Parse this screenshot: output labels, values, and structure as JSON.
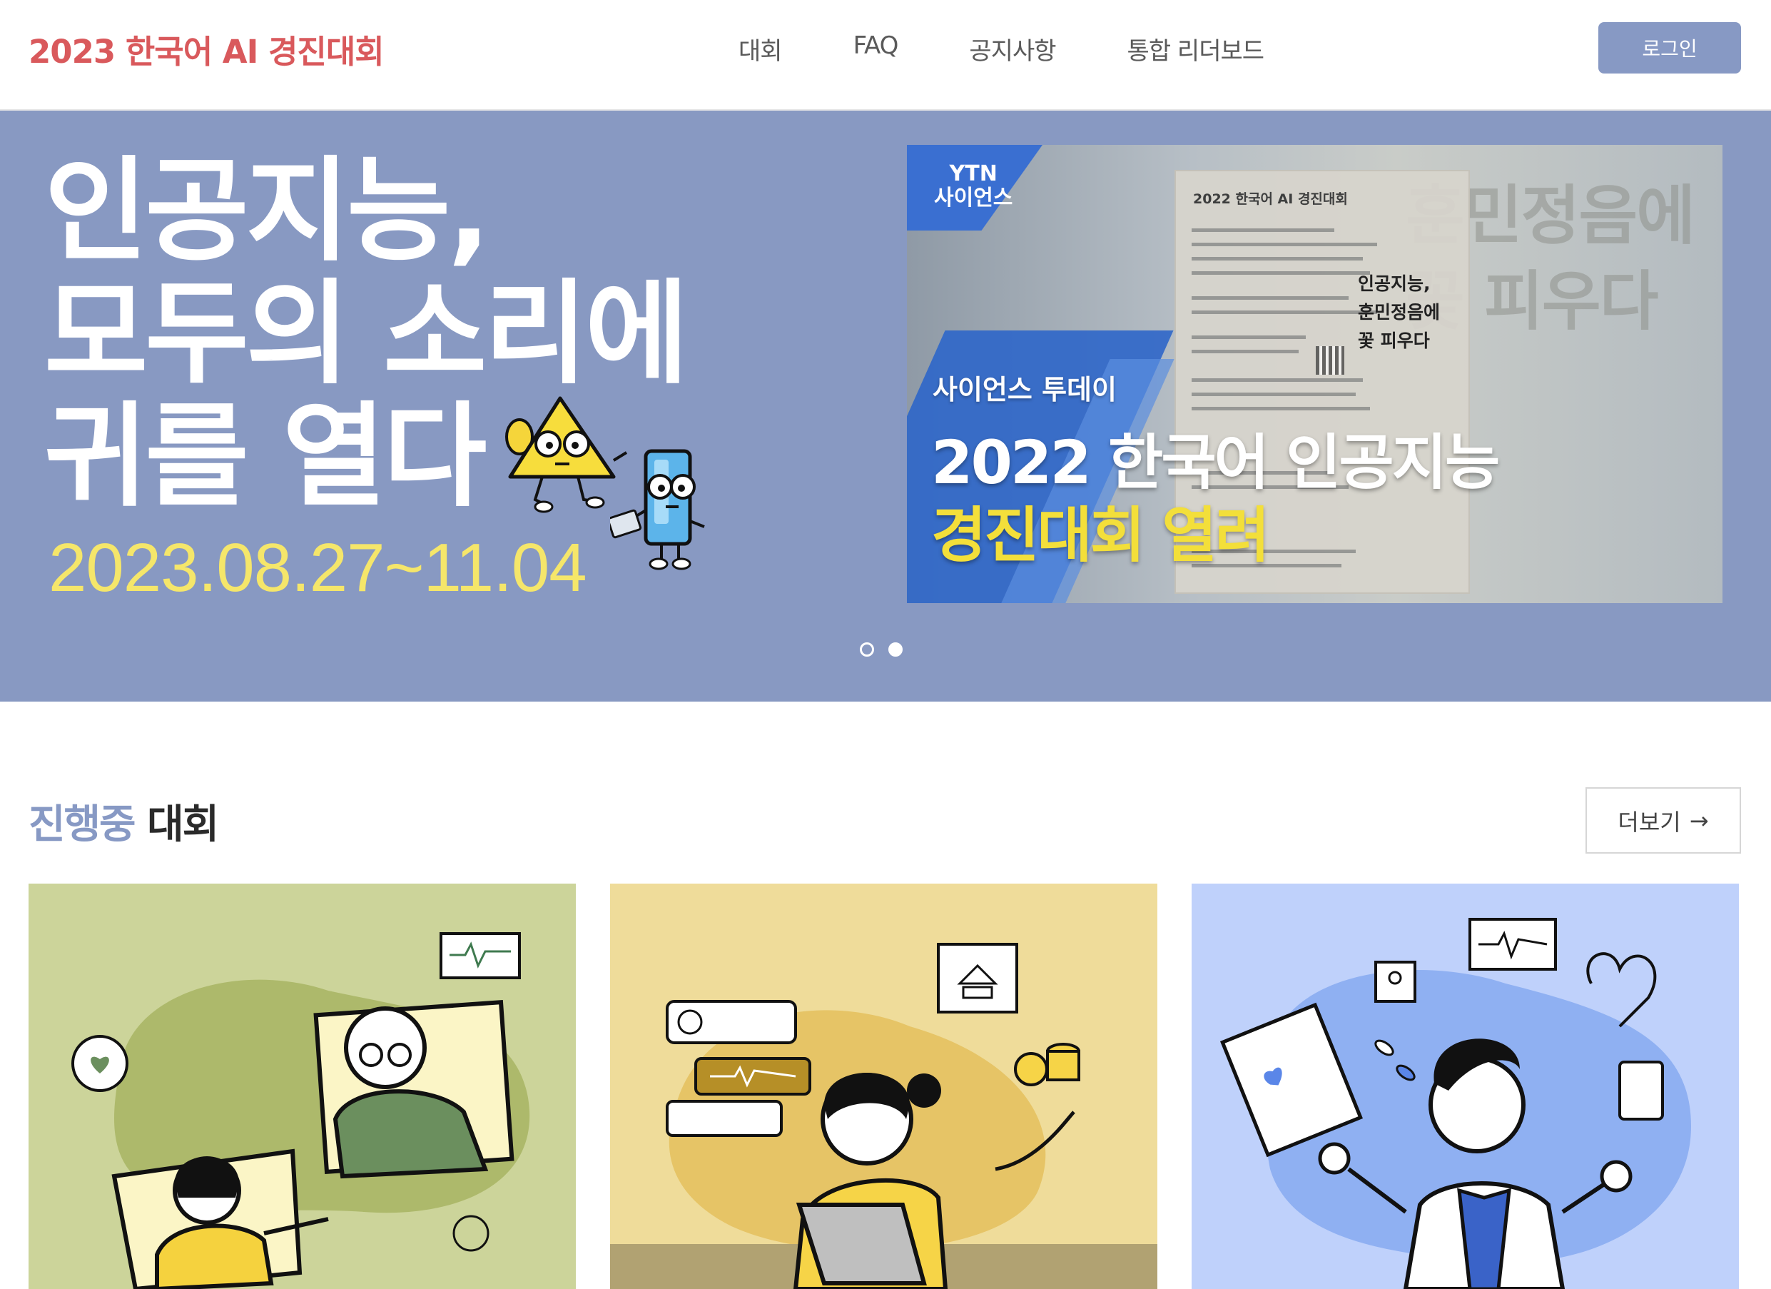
{
  "header": {
    "brand": "2023 한국어 AI 경진대회",
    "nav": [
      "대회",
      "FAQ",
      "공지사항",
      "통합 리더보드"
    ],
    "login_label": "로그인"
  },
  "hero": {
    "headline": [
      "인공지능,",
      "모두의 소리에",
      "귀를 열다"
    ],
    "date": "2023.08.27~11.04",
    "news": {
      "channel": [
        "YTN",
        "사이언스"
      ],
      "program": "사이언스 투데이",
      "title_line1": "2022 한국어 인공지능",
      "title_line2": "경진대회 열려",
      "poster_title": "2022 한국어 AI 경진대회",
      "poster_side": [
        "인공지능,",
        "훈민정음에",
        "꽃 피우다"
      ]
    },
    "slides_total": 2,
    "active_slide": 2
  },
  "section": {
    "title_accent": "진행중",
    "title_main": "대회",
    "more_label": "더보기",
    "more_arrow": "→"
  },
  "cards": [
    {
      "icon": "video-call-illustration",
      "bg": "#ccd49a"
    },
    {
      "icon": "laptop-finance-illustration",
      "bg": "#efdc9a"
    },
    {
      "icon": "doctor-medical-illustration",
      "bg": "#bfd1fb"
    }
  ],
  "colors": {
    "brand": "#d9595c",
    "accent": "#8799c4",
    "hero_bg": "#8899c2",
    "date_yellow": "#f5e66a"
  }
}
